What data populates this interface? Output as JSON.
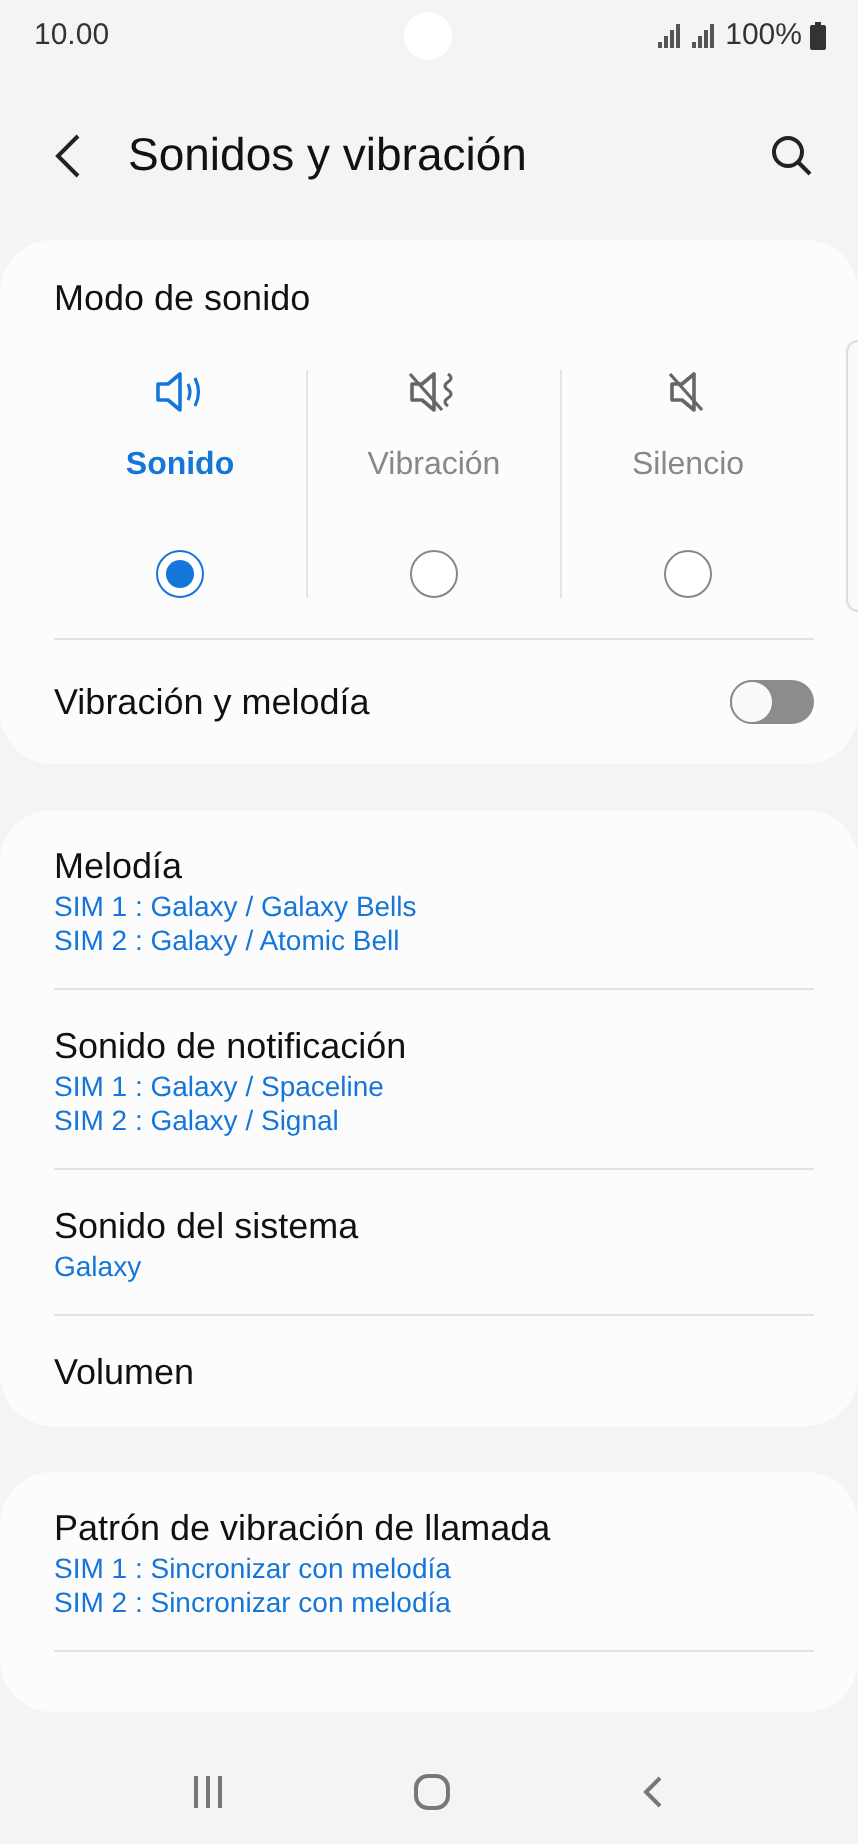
{
  "status_bar": {
    "time": "10.00",
    "battery": "100%"
  },
  "header": {
    "title": "Sonidos y vibración"
  },
  "sound_mode": {
    "title": "Modo de sonido",
    "options": [
      {
        "kind": "sound",
        "label": "Sonido",
        "selected": true
      },
      {
        "kind": "vibrate",
        "label": "Vibración",
        "selected": false
      },
      {
        "kind": "mute",
        "label": "Silencio",
        "selected": false
      }
    ],
    "toggle": {
      "label": "Vibración y melodía",
      "on": false
    }
  },
  "sections": [
    {
      "items": [
        {
          "title": "Melodía",
          "subtitles": [
            "SIM 1 : Galaxy / Galaxy Bells",
            "SIM 2 : Galaxy / Atomic Bell"
          ]
        },
        {
          "title": "Sonido de notificación",
          "subtitles": [
            "SIM 1 : Galaxy / Spaceline",
            "SIM 2 : Galaxy / Signal"
          ]
        },
        {
          "title": "Sonido del sistema",
          "subtitles": [
            "Galaxy"
          ]
        },
        {
          "title": "Volumen"
        }
      ]
    },
    {
      "items": [
        {
          "title": "Patrón de vibración de llamada",
          "subtitles": [
            "SIM 1 : Sincronizar con melodía",
            "SIM 2 : Sincronizar con melodía"
          ]
        }
      ]
    }
  ]
}
